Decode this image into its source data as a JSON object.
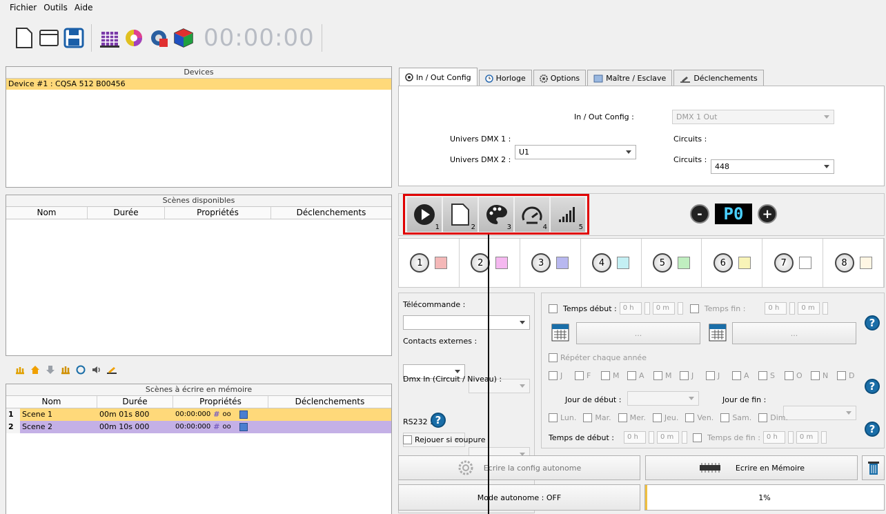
{
  "menu": {
    "items": [
      "Fichier",
      "Outils",
      "Aide"
    ]
  },
  "toolbar": {
    "clock": "00:00:00",
    "icons": [
      "new-file-icon",
      "open-folder-icon",
      "save-icon",
      "grid-chart-icon",
      "color-wheel-icon",
      "gear-cube-icon",
      "rubik-cube-icon"
    ]
  },
  "devices": {
    "title": "Devices",
    "items": [
      "Device #1 : CQSA 512 B00456"
    ]
  },
  "scenes": {
    "title": "Scènes disponibles",
    "columns": [
      "Nom",
      "Durée",
      "Propriétés",
      "Déclenchements"
    ]
  },
  "memory": {
    "title": "Scènes à écrire en mémoire",
    "columns": [
      "Nom",
      "Durée",
      "Propriétés",
      "Déclenchements"
    ],
    "rows": [
      {
        "index": "1",
        "name": "Scene 1",
        "duration": "00m 01s 800",
        "time": "00:00:000",
        "loop": "oo",
        "color": "#ffd97a"
      },
      {
        "index": "2",
        "name": "Scene 2",
        "duration": "00m 10s 000",
        "time": "00:00:000",
        "loop": "oo",
        "color": "#c4b0e6"
      }
    ]
  },
  "tabs": [
    {
      "label": "In / Out Config",
      "icon": "io-icon",
      "active": true
    },
    {
      "label": "Horloge",
      "icon": "clock-icon",
      "active": false
    },
    {
      "label": "Options",
      "icon": "gear-icon",
      "active": false
    },
    {
      "label": "Maître / Esclave",
      "icon": "master-slave-icon",
      "active": false
    },
    {
      "label": "Déclenchements",
      "icon": "trigger-icon",
      "active": false
    }
  ],
  "ioconfig": {
    "io_label": "In / Out Config :",
    "io_value": "DMX 1 Out",
    "u1_label": "Univers DMX 1 :",
    "u1_value": "U1",
    "u2_label": "Univers DMX 2 :",
    "u2_value": "",
    "c1_label": "Circuits :",
    "c1_value": "448",
    "c2_label": "Circuits :",
    "c2_value": ""
  },
  "modes": [
    {
      "num": "1",
      "icon": "play-icon"
    },
    {
      "num": "2",
      "icon": "page-icon"
    },
    {
      "num": "3",
      "icon": "palette-icon"
    },
    {
      "num": "4",
      "icon": "speed-icon"
    },
    {
      "num": "5",
      "icon": "level-icon"
    }
  ],
  "program": {
    "value": "P0",
    "minus": "-",
    "plus": "+"
  },
  "scenes_buttons": [
    {
      "num": "1",
      "color": "#f4b8b8"
    },
    {
      "num": "2",
      "color": "#f5b8f0"
    },
    {
      "num": "3",
      "color": "#b8b8f0"
    },
    {
      "num": "4",
      "color": "#c4f0f4"
    },
    {
      "num": "5",
      "color": "#c0eec0"
    },
    {
      "num": "6",
      "color": "#f8f4b8"
    },
    {
      "num": "7",
      "color": "#ffffff"
    },
    {
      "num": "8",
      "color": "#fff6e4"
    }
  ],
  "left_ctrl": {
    "remote": "Télécommande :",
    "contacts": "Contacts externes :",
    "dmxin": "Dmx In (Circuit / Niveau) :",
    "rs232": "RS232 :",
    "replay": "Rejouer si coupure"
  },
  "schedule": {
    "start_time": "Temps début :",
    "end_time": "Temps fin :",
    "h": "0 h",
    "m": "0 m",
    "ellipsis": "...",
    "repeat": "Répéter chaque année",
    "months": [
      "J",
      "F",
      "M",
      "A",
      "M",
      "J",
      "J",
      "A",
      "S",
      "O",
      "N",
      "D"
    ],
    "day_start": "Jour de début :",
    "day_end": "Jour de fin :",
    "days": [
      "Lun.",
      "Mar.",
      "Mer.",
      "Jeu.",
      "Ven.",
      "Sam.",
      "Dim."
    ],
    "start_time2": "Temps de début :",
    "end_time2": "Temps de fin :",
    "help": "?"
  },
  "actions": {
    "write_config": "Ecrire la config autonome",
    "write_memory": "Ecrire en Mémoire",
    "mode": "Mode autonome : OFF",
    "progress_text": "1%",
    "progress": 0.01
  },
  "colors": {
    "selection": "#ffd97a",
    "accent": "#e00000",
    "help": "#1a6ea8"
  }
}
